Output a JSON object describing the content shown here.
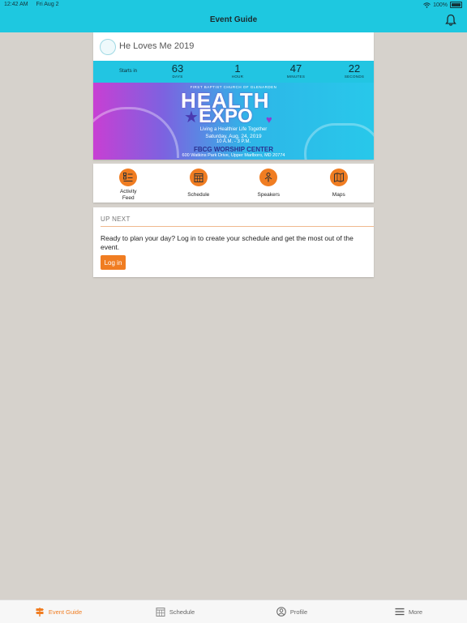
{
  "status_bar": {
    "time": "12:42 AM",
    "date": "Fri Aug 2",
    "battery": "100%"
  },
  "nav": {
    "title": "Event Guide"
  },
  "event": {
    "name": "He Loves Me 2019",
    "countdown": {
      "starts_label": "Starts in",
      "units": [
        {
          "value": "63",
          "label": "DAYS"
        },
        {
          "value": "1",
          "label": "HOUR"
        },
        {
          "value": "47",
          "label": "MINUTES"
        },
        {
          "value": "22",
          "label": "SECONDS"
        }
      ]
    },
    "banner": {
      "top_text": "FIRST BAPTIST CHURCH OF GLENARDEN",
      "title_line1": "HEALTH",
      "title_line2": "EXPO",
      "tagline": "Living a Healthier Life Together",
      "date": "Saturday, Aug. 24, 2019",
      "time": "10 A.M. - 3 P.M.",
      "venue": "FBCG WORSHIP CENTER",
      "address": "600 Watkins Park Drive, Upper Marlboro, MD 20774"
    }
  },
  "shortcuts": [
    {
      "line1": "Activity",
      "line2": "Feed",
      "icon": "list-icon"
    },
    {
      "line1": "Schedule",
      "icon": "calendar-icon"
    },
    {
      "line1": "Speakers",
      "icon": "microphone-icon"
    },
    {
      "line1": "Maps",
      "icon": "map-icon"
    }
  ],
  "up_next": {
    "heading": "UP NEXT",
    "message": "Ready to plan your day? Log in to create your schedule and get the most out of the event.",
    "login_label": "Log in"
  },
  "tab_bar": [
    {
      "label": "Event Guide",
      "icon": "signpost-icon",
      "active": true
    },
    {
      "label": "Schedule",
      "icon": "calendar-icon",
      "active": false
    },
    {
      "label": "Profile",
      "icon": "profile-icon",
      "active": false
    },
    {
      "label": "More",
      "icon": "menu-icon",
      "active": false
    }
  ],
  "colors": {
    "accent": "#f07d22",
    "header": "#1ec8e0",
    "background": "#d6d2cc"
  }
}
